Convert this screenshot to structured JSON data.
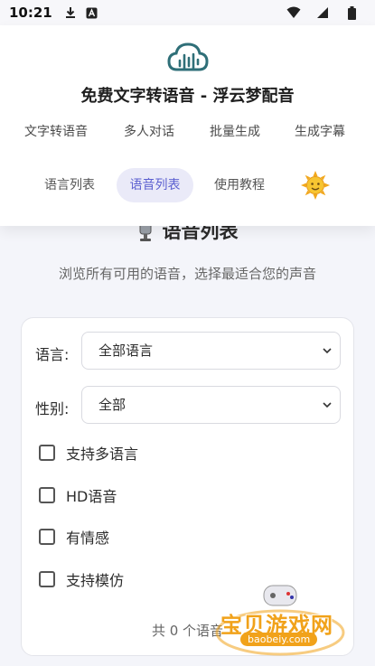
{
  "status_bar": {
    "time": "10:21",
    "icons": [
      "download-icon",
      "a-icon",
      "wifi-icon",
      "signal-icon",
      "battery-icon"
    ]
  },
  "header": {
    "title": "免费文字转语音 - 浮云梦配音",
    "nav": [
      "文字转语音",
      "多人对话",
      "批量生成",
      "生成字幕"
    ],
    "sub_nav": [
      "语言列表",
      "语音列表",
      "使用教程"
    ],
    "active_sub_nav": "语音列表",
    "theme_icon": "sun-icon"
  },
  "content": {
    "heading": "语音列表",
    "heading_icon": "microphone-icon",
    "description": "浏览所有可用的语音，选择最适合您的声音",
    "filters": {
      "language_label": "语言:",
      "language_value": "全部语言",
      "gender_label": "性别:",
      "gender_value": "全部",
      "checkboxes": [
        {
          "label": "支持多语言",
          "checked": false
        },
        {
          "label": "HD语音",
          "checked": false
        },
        {
          "label": "有情感",
          "checked": false
        },
        {
          "label": "支持模仿",
          "checked": false
        }
      ]
    },
    "count_text": "共 0 个语音"
  },
  "watermark": {
    "text": "宝贝游戏网",
    "url": "baobeiy.com"
  },
  "colors": {
    "accent": "#5b5fd0",
    "active_tab_bg": "#eaeaf8",
    "logo": "#2f6f78",
    "watermark": "#f1a21a"
  }
}
